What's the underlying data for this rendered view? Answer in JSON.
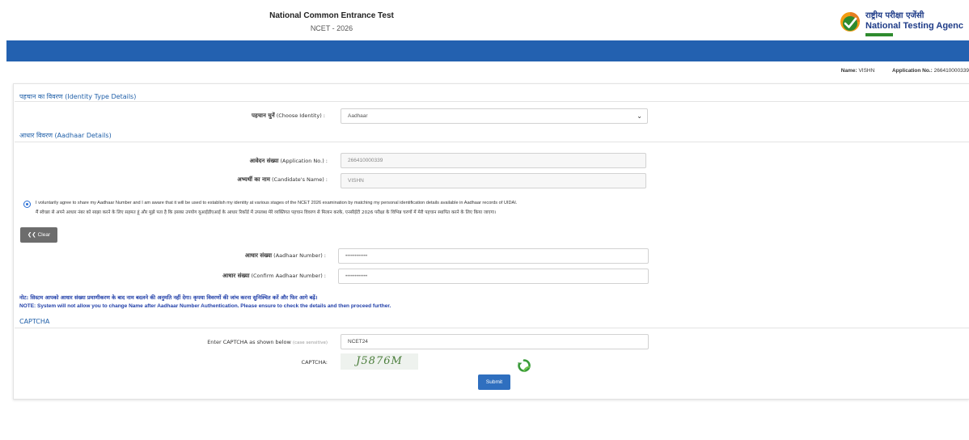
{
  "header": {
    "title": "National Common Entrance Test",
    "subtitle": "NCET - 2026",
    "logo_hindi": "राष्ट्रीय परीक्षा एजेंसी",
    "logo_english": "National Testing Agenc"
  },
  "user_info": {
    "name_label": "Name:",
    "name_value": "VISHN",
    "application_label": "Application No.:",
    "application_value": "266410000339"
  },
  "identity_section": {
    "heading": "पहचान का विवरण (Identity Type Details)",
    "choose_label_hi": "पहचान चुनें",
    "choose_label_en": "(Choose Identity) :",
    "choose_value": "Aadhaar"
  },
  "aadhaar_section": {
    "heading": "आधार विवरण (Aadhaar Details)",
    "application_no_label_hi": "आवेदन संख्या",
    "application_no_label_en": "(Application No.) :",
    "application_no_value": "266410000339",
    "candidate_name_label_hi": "अभ्यर्थी का नाम",
    "candidate_name_label_en": "(Candidate's Name) :",
    "candidate_name_value": "VISHN",
    "consent_en": "I voluntarily agree to share my Aadhaar Number and I am aware that it will be used to establish my identity at various stages of the NCET 2026 examination by matching my personal identification details available in Aadhaar records of UIDAI.",
    "consent_hi": "मैं स्वेच्छा से अपने आधार नंबर को साझा करने के लिए सहमत हूं और मुझे पता है कि इसका उपयोग यूआईडीएआई के आधार रिकॉर्ड में उपलब्ध मेरे व्यक्तिगत पहचान विवरण से मिलान करके, एनसीईटी 2026 परीक्षा के विभिन्न चरणों में मेरी पहचान स्थापित करने के लिए किया जाएगा।",
    "clear_button": "Clear",
    "aadhaar_number_label_hi": "आधार संख्या",
    "aadhaar_number_label_en": "(Aadhaar Number) :",
    "aadhaar_number_value": "••••••••••••",
    "confirm_aadhaar_label_hi": "आधार संख्या",
    "confirm_aadhaar_label_en": "(Confirm Aadhaar Number) :",
    "confirm_aadhaar_value": "••••••••••••"
  },
  "notes": {
    "note_hi": "नोट: सिस्टम आपको आधार संख्या प्रमाणीकरण के बाद नाम बदलने की अनुमति नहीं देगा। कृपया विवरणों की जांच करना सुनिश्चित करें और फिर आगे बढ़ें।",
    "note_en": "NOTE: System will not allow you to change Name after Aadhaar Number Authentication. Please ensure to check the details and then proceed further."
  },
  "captcha_section": {
    "heading": "CAPTCHA",
    "enter_label": "Enter CAPTCHA as shown below",
    "enter_hint": "(case sensitive)",
    "input_value": "NCET24",
    "captcha_label": "CAPTCHA:",
    "captcha_text": "J5876M",
    "submit_button": "Submit"
  },
  "colors": {
    "header_bar": "#2361b0",
    "section_heading": "#1f5fa8",
    "note_text": "#1f3ea8",
    "submit_button": "#2f6fbf",
    "clear_button": "#6d6d6d"
  },
  "icons": {
    "select_chevron": "chevron-down-icon",
    "captcha_refresh": "refresh-icon",
    "clear": "arrow-left-icon",
    "logo": "nta-logo"
  }
}
